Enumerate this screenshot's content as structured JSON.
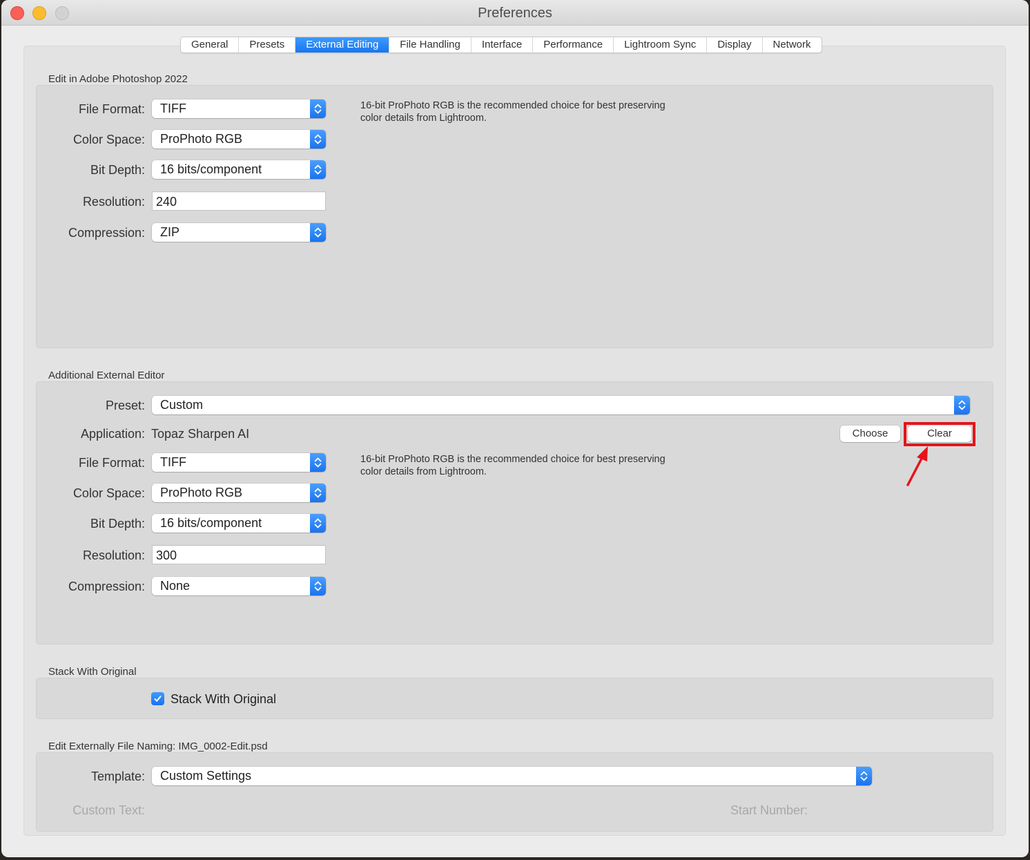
{
  "window": {
    "title": "Preferences"
  },
  "tabs": [
    {
      "label": "General",
      "active": false
    },
    {
      "label": "Presets",
      "active": false
    },
    {
      "label": "External Editing",
      "active": true
    },
    {
      "label": "File Handling",
      "active": false
    },
    {
      "label": "Interface",
      "active": false
    },
    {
      "label": "Performance",
      "active": false
    },
    {
      "label": "Lightroom Sync",
      "active": false
    },
    {
      "label": "Display",
      "active": false
    },
    {
      "label": "Network",
      "active": false
    }
  ],
  "photoshop": {
    "section_title": "Edit in Adobe Photoshop 2022",
    "file_format": {
      "label": "File Format:",
      "value": "TIFF"
    },
    "color_space": {
      "label": "Color Space:",
      "value": "ProPhoto RGB"
    },
    "bit_depth": {
      "label": "Bit Depth:",
      "value": "16 bits/component"
    },
    "resolution": {
      "label": "Resolution:",
      "value": "240"
    },
    "compression": {
      "label": "Compression:",
      "value": "ZIP"
    },
    "note_line1": "16-bit ProPhoto RGB is the recommended choice for best preserving",
    "note_line2": "color details from Lightroom."
  },
  "additional": {
    "section_title": "Additional External Editor",
    "preset": {
      "label": "Preset:",
      "value": "Custom"
    },
    "application": {
      "label": "Application:",
      "value": "Topaz Sharpen AI"
    },
    "choose_label": "Choose",
    "clear_label": "Clear",
    "file_format": {
      "label": "File Format:",
      "value": "TIFF"
    },
    "color_space": {
      "label": "Color Space:",
      "value": "ProPhoto RGB"
    },
    "bit_depth": {
      "label": "Bit Depth:",
      "value": "16 bits/component"
    },
    "resolution": {
      "label": "Resolution:",
      "value": "300"
    },
    "compression": {
      "label": "Compression:",
      "value": "None"
    },
    "note_line1": "16-bit ProPhoto RGB is the recommended choice for best preserving",
    "note_line2": "color details from Lightroom."
  },
  "stack": {
    "section_title": "Stack With Original",
    "checkbox_label": "Stack With Original",
    "checked": true
  },
  "naming": {
    "section_title": "Edit Externally File Naming:  IMG_0002-Edit.psd",
    "template": {
      "label": "Template:",
      "value": "Custom Settings"
    },
    "custom_text_label": "Custom Text:",
    "start_number_label": "Start Number:"
  },
  "annotation": {
    "highlight_color": "#e5141b",
    "target": "Clear"
  },
  "colors": {
    "accent": "#1a73ef",
    "window_bg": "#ececec",
    "panel_bg": "#d9d9d9"
  }
}
